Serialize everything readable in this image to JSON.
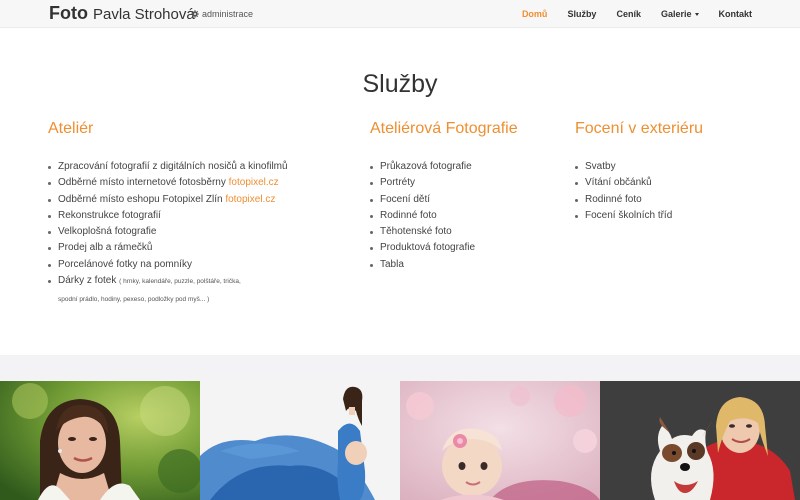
{
  "header": {
    "brand_bold": "Foto",
    "brand_name": "Pavla Strohová",
    "admin_label": "administrace",
    "nav": [
      {
        "label": "Domů",
        "active": true
      },
      {
        "label": "Služby",
        "active": false
      },
      {
        "label": "Ceník",
        "active": false
      },
      {
        "label": "Galerie",
        "active": false
      },
      {
        "label": "Kontakt",
        "active": false
      }
    ]
  },
  "main": {
    "title": "Služby",
    "columns": [
      {
        "heading": "Ateliér",
        "items": [
          {
            "text": "Zpracování fotografií z digitálních nosičů a kinofilmů"
          },
          {
            "text": "Odběrné místo internetové fotosběrny ",
            "link": "fotopixel.cz"
          },
          {
            "text": "Odběrné místo eshopu Fotopixel Zlín ",
            "link": "fotopixel.cz"
          },
          {
            "text": "Rekonstrukce fotografií"
          },
          {
            "text": "Velkoplošná fotografie"
          },
          {
            "text": "Prodej alb a rámečků"
          },
          {
            "text": "Porcelánové fotky na pomníky"
          },
          {
            "text": "Dárky z fotek ",
            "note": "( hrnky, kalendáře, puzzle, polštáře, trička,",
            "note2": "spodní prádlo, hodiny, pexeso, podložky pod myš... )"
          }
        ]
      },
      {
        "heading": "Ateliérová Fotografie",
        "items": [
          {
            "text": "Průkazová fotografie"
          },
          {
            "text": "Portréty"
          },
          {
            "text": "Focení dětí"
          },
          {
            "text": "Rodinné foto"
          },
          {
            "text": "Těhotenské foto"
          },
          {
            "text": "Produktová fotografie"
          },
          {
            "text": "Tabla"
          }
        ]
      },
      {
        "heading": "Focení v exteriéru",
        "items": [
          {
            "text": "Svatby"
          },
          {
            "text": "Vítání občánků"
          },
          {
            "text": "Rodinné foto"
          },
          {
            "text": "Focení školních tříd"
          }
        ]
      }
    ]
  },
  "colors": {
    "accent": "#ee8f31",
    "navbar_bg": "#f7f7f7",
    "band_bg": "#f3f3f5"
  }
}
